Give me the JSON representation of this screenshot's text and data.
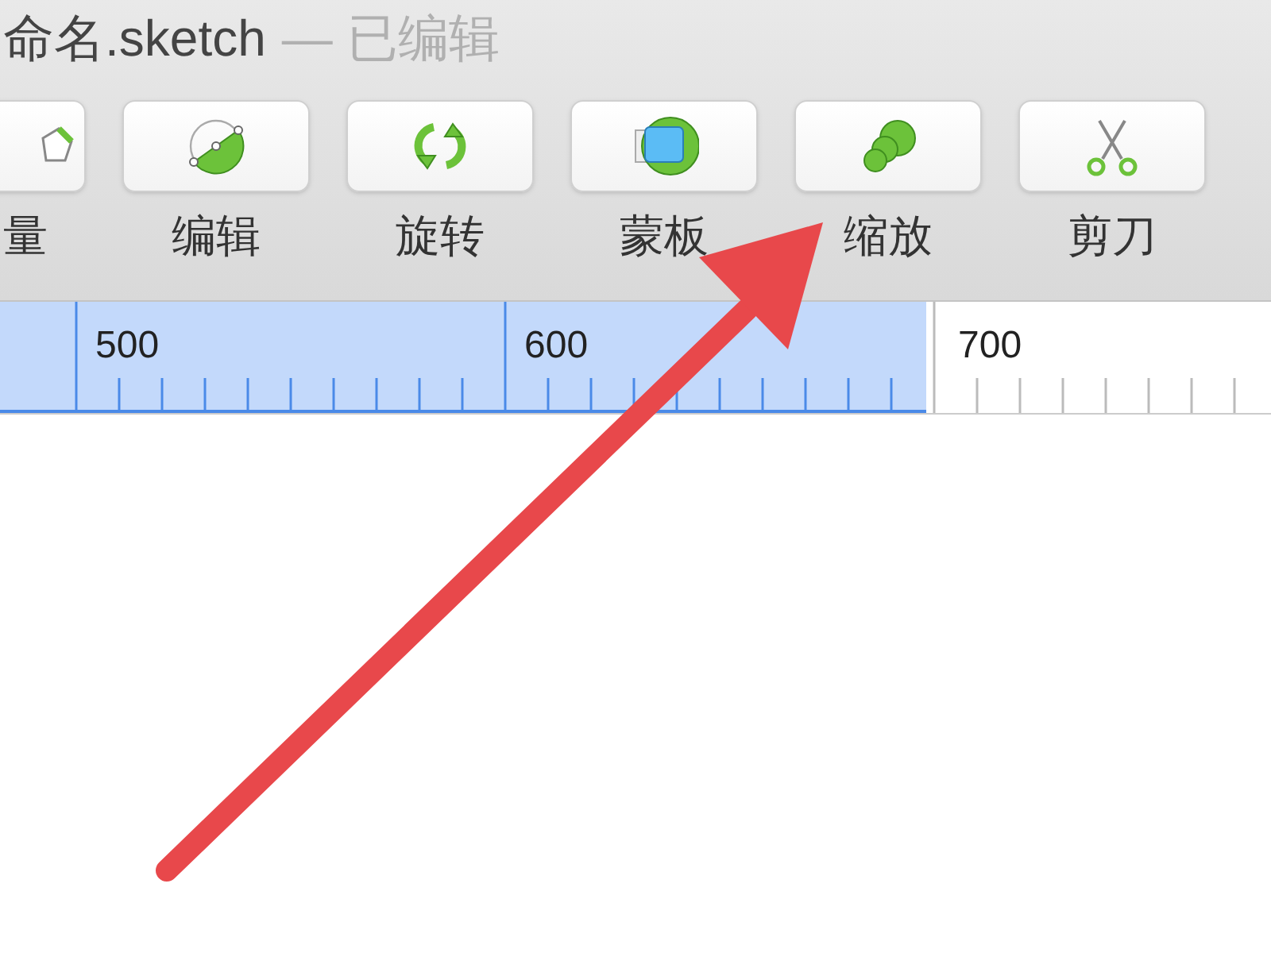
{
  "window": {
    "title": "命名.sketch",
    "status": "— 已编辑"
  },
  "toolbar": {
    "buttons": [
      {
        "label": "量"
      },
      {
        "label": "编辑"
      },
      {
        "label": "旋转"
      },
      {
        "label": "蒙板"
      },
      {
        "label": "缩放"
      },
      {
        "label": "剪刀"
      }
    ]
  },
  "ruler": {
    "labels": [
      "500",
      "600",
      "700"
    ]
  }
}
